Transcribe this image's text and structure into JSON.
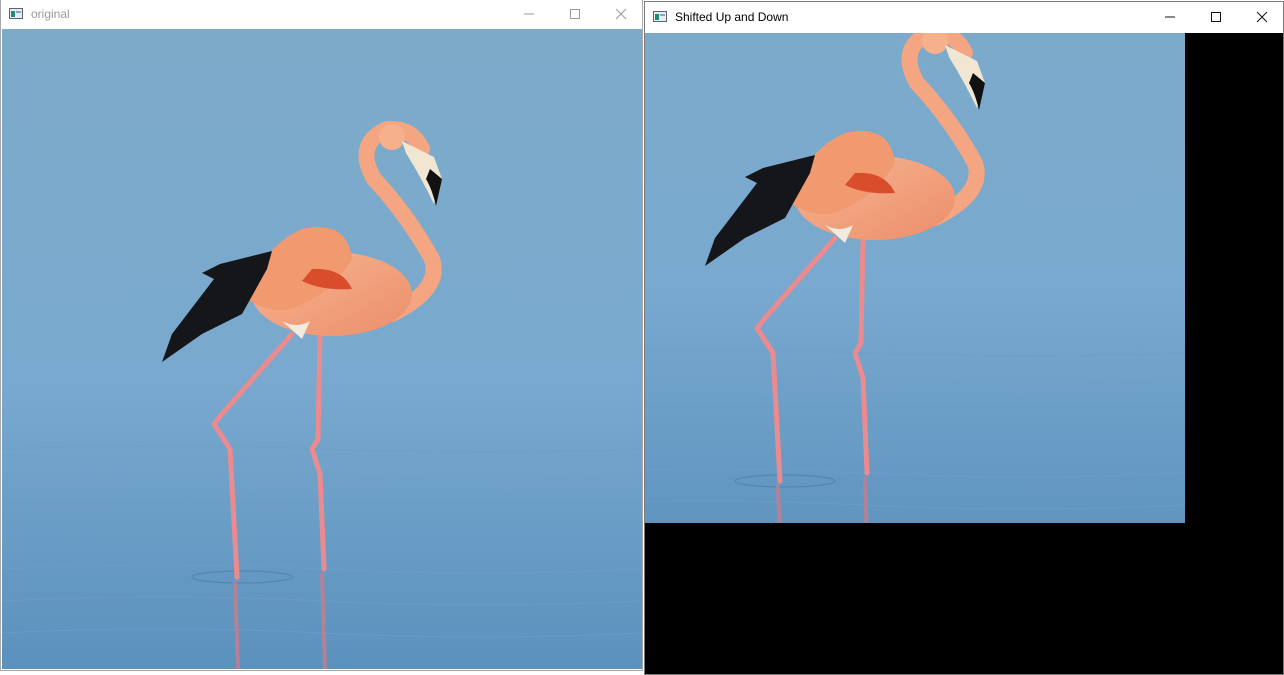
{
  "windows": [
    {
      "title": "original"
    },
    {
      "title": "Shifted Up and Down"
    }
  ],
  "colors": {
    "sky": "#7faccc",
    "water": "#5f94bf",
    "flamingo": "#f2a07a",
    "wing_black": "#15161a",
    "legs": "#e88a8e",
    "shift_fill": "#000000"
  },
  "icons": [
    "window-app-icon",
    "minimize-icon",
    "maximize-icon",
    "close-icon"
  ]
}
